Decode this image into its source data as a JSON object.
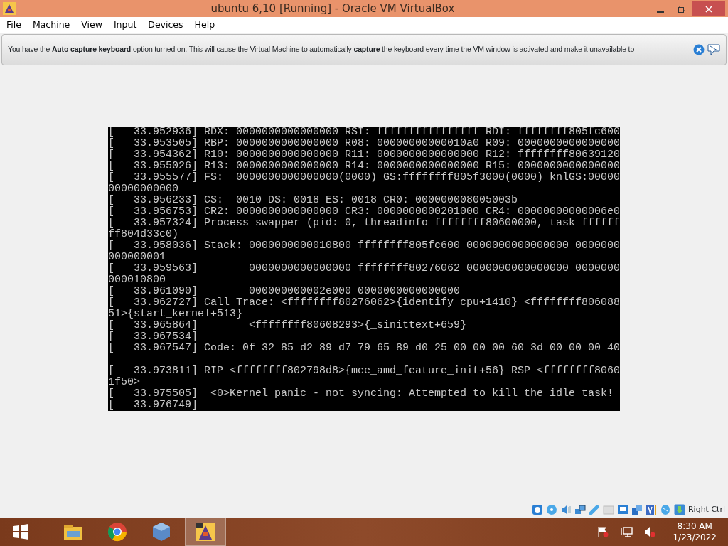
{
  "window": {
    "title": "ubuntu 6,10 [Running] - Oracle VM VirtualBox"
  },
  "menu": [
    "File",
    "Machine",
    "View",
    "Input",
    "Devices",
    "Help"
  ],
  "notice": {
    "text": "You have the **Auto capture keyboard** option turned on. This will cause the Virtual Machine to automatically **capture** the keyboard every time the VM window is activated and make it unavailable to"
  },
  "console": {
    "lines": [
      {
        "text": "[   33.952936] RDX: 0000000000000000 RSI: ffffffffffffffff RDI: ffffffff805fc600"
      },
      {
        "text": "[   33.953505] RBP: 0000000000000000 R08: 00000000000010a0 R09: 0000000000000000"
      },
      {
        "text": "[   33.954362] R10: 0000000000000000 R11: 0000000000000000 R12: ffffffff80639120"
      },
      {
        "text": "[   33.955026] R13: 0000000000000000 R14: 0000000000000000 R15: 0000000000000000"
      },
      {
        "text": "[   33.955577] FS:  0000000000000000(0000) GS:ffffffff805f3000(0000) knlGS:00000"
      },
      {
        "text": "00000000000"
      },
      {
        "text": "[   33.956233] CS:  0010 DS: 0018 ES: 0018 CR0: 000000008005003b"
      },
      {
        "text": "[   33.956753] CR2: 0000000000000000 CR3: 0000000000201000 CR4: 00000000000006e0"
      },
      {
        "text": "[   33.957324] Process swapper (pid: 0, threadinfo ffffffff80600000, task ffffff"
      },
      {
        "text": "ff804d33c0)"
      },
      {
        "text": "[   33.958036] Stack: 0000000000010800 ffffffff805fc600 0000000000000000 0000000"
      },
      {
        "text": "000000001"
      },
      {
        "text": "[   33.959563]        0000000000000000 ffffffff80276062 0000000000000000 0000000"
      },
      {
        "text": "000010800"
      },
      {
        "text": "[   33.961090]        000000000002e000 0000000000000000"
      },
      {
        "text": "[   33.962727] Call Trace: <ffffffff80276062>{identify_cpu+1410} <ffffffff806088"
      },
      {
        "text": "51>{start_kernel+513}"
      },
      {
        "text": "[   33.965864]        <ffffffff80608293>{_sinittext+659}"
      },
      {
        "text": "[   33.967534]"
      },
      {
        "text": "[   33.967547] Code: 0f 32 85 d2 89 d7 79 65 89 d0 25 00 00 00 60 3d 00 00 00 40",
        "gap_after": true
      },
      {
        "text": "[   33.973811] RIP <ffffffff802798d8>{mce_amd_feature_init+56} RSP <ffffffff8060"
      },
      {
        "text": "1f50>"
      },
      {
        "text": "[   33.975505]  <0>Kernel panic - not syncing: Attempted to kill the idle task!"
      },
      {
        "text": "[   33.976749]"
      }
    ]
  },
  "status_bar": {
    "host_key": "Right Ctrl"
  },
  "taskbar": {
    "apps": [
      {
        "selected": false
      },
      {
        "selected": false
      },
      {
        "selected": false
      },
      {
        "selected": true
      }
    ],
    "time": "8:30 AM",
    "date": "1/23/2022"
  }
}
